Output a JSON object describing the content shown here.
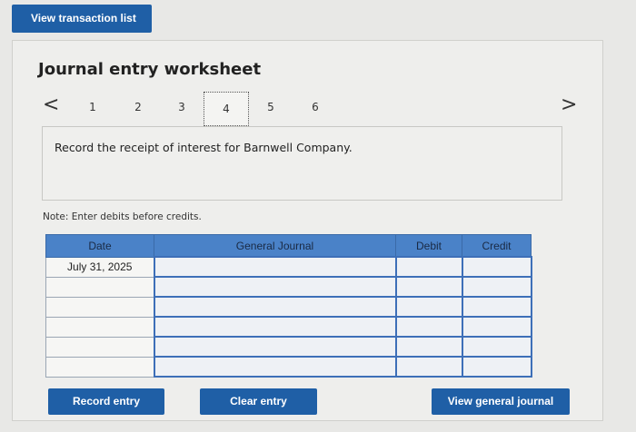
{
  "header": {
    "view_transaction_list": "View transaction list"
  },
  "worksheet": {
    "title": "Journal entry worksheet",
    "steps": [
      "1",
      "2",
      "3",
      "4",
      "5",
      "6"
    ],
    "current_step": "4",
    "prev_arrow": "<",
    "next_arrow": ">",
    "prompt": "Record the receipt of interest for Barnwell Company.",
    "note": "Note: Enter debits before credits."
  },
  "table": {
    "headers": {
      "date": "Date",
      "journal": "General Journal",
      "debit": "Debit",
      "credit": "Credit"
    },
    "rows": [
      {
        "date": "July 31, 2025",
        "account": "",
        "debit": "",
        "credit": ""
      },
      {
        "date": "",
        "account": "",
        "debit": "",
        "credit": ""
      },
      {
        "date": "",
        "account": "",
        "debit": "",
        "credit": ""
      },
      {
        "date": "",
        "account": "",
        "debit": "",
        "credit": ""
      },
      {
        "date": "",
        "account": "",
        "debit": "",
        "credit": ""
      },
      {
        "date": "",
        "account": "",
        "debit": "",
        "credit": ""
      }
    ]
  },
  "buttons": {
    "record_entry": "Record entry",
    "clear_entry": "Clear entry",
    "view_general_journal": "View general journal"
  },
  "colors": {
    "accent": "#1f5fa6",
    "table_header": "#4a82c8"
  }
}
